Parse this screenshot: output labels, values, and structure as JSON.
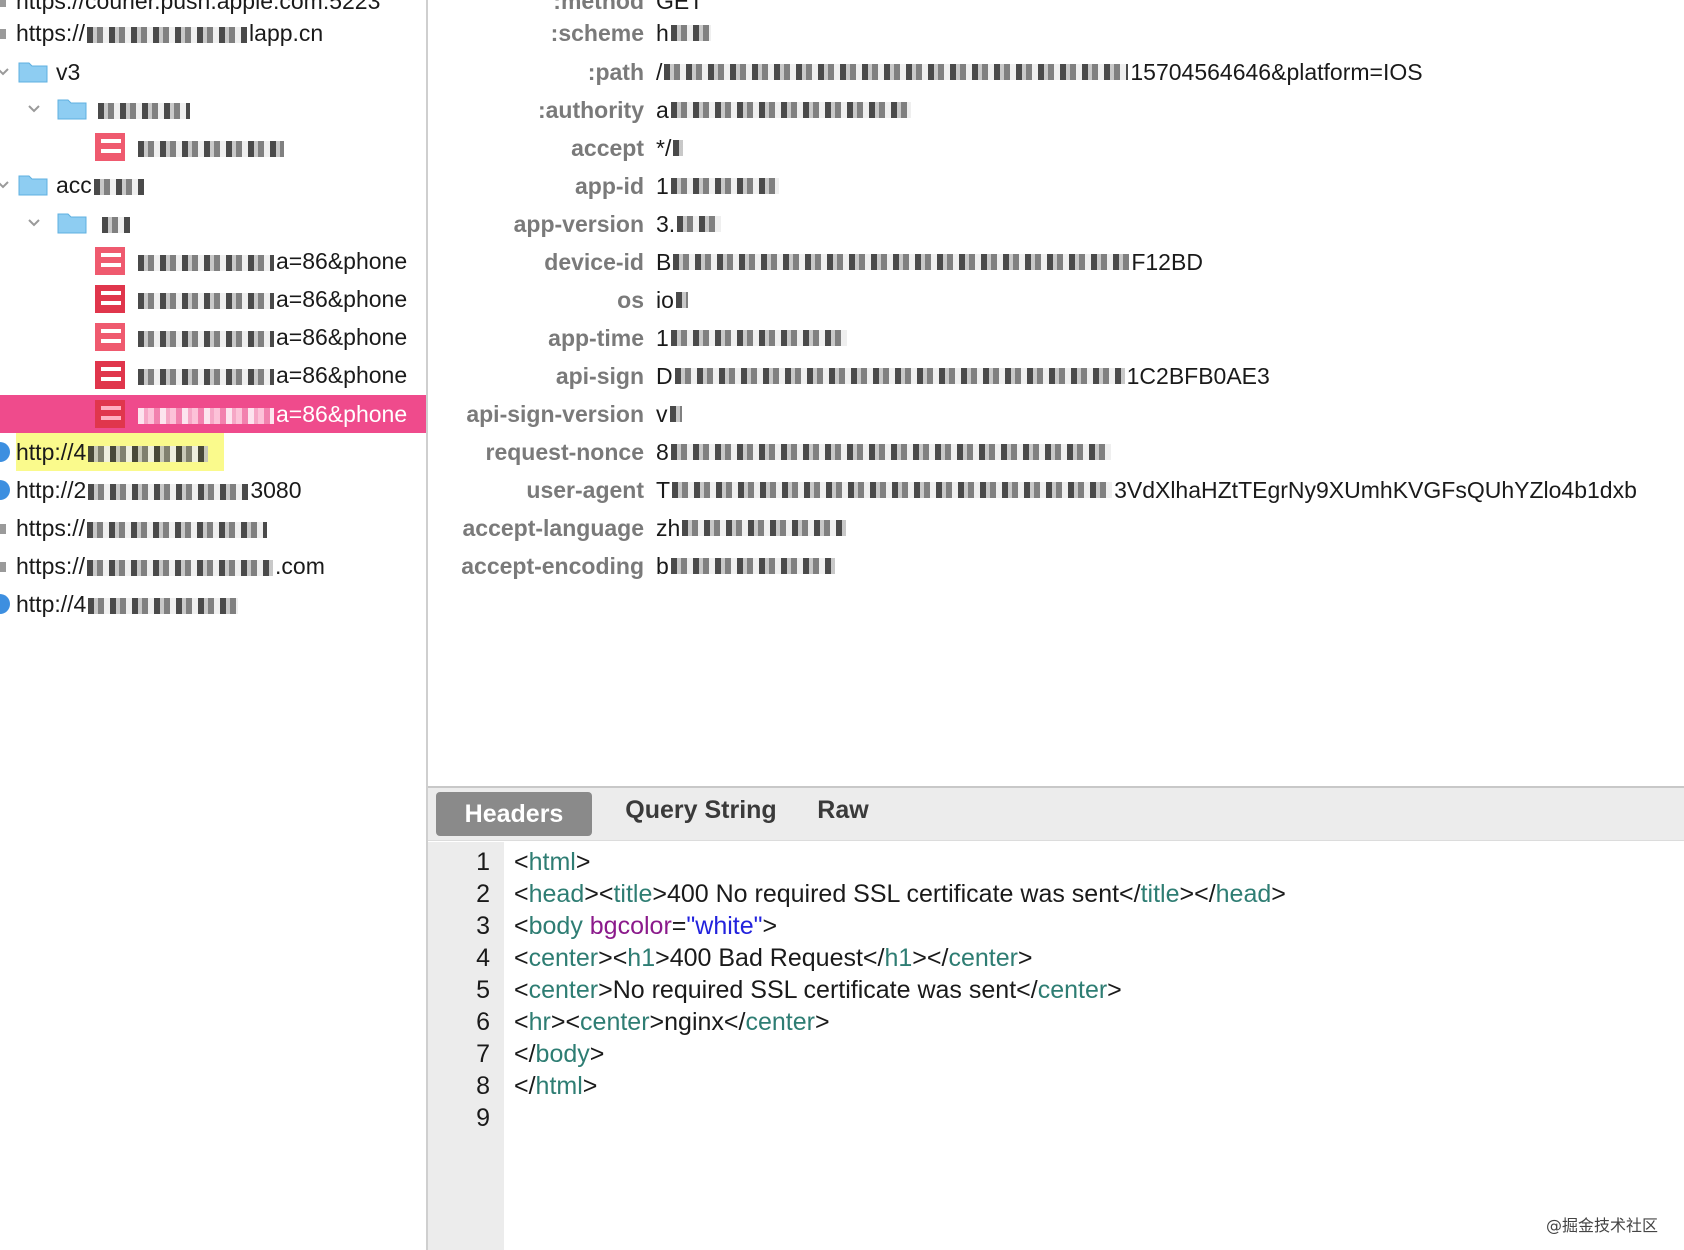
{
  "tree": {
    "rows": [
      {
        "type": "host-secure",
        "label": "https://courier.push.apple.com:5223"
      },
      {
        "type": "host-secure",
        "label_prefix": "https://",
        "label_suffix": "lapp.cn"
      },
      {
        "type": "folder",
        "label": "v3",
        "expanded": true
      },
      {
        "type": "folder",
        "label": "",
        "expanded": true
      },
      {
        "type": "request",
        "label": ""
      },
      {
        "type": "folder",
        "label": "acc",
        "expanded": true
      },
      {
        "type": "folder",
        "label": "",
        "expanded": true
      },
      {
        "type": "request",
        "label_suffix": "a=86&phone"
      },
      {
        "type": "request",
        "label_suffix": "a=86&phone"
      },
      {
        "type": "request",
        "label_suffix": "a=86&phone"
      },
      {
        "type": "request",
        "label_suffix": "a=86&phone"
      },
      {
        "type": "request",
        "label_suffix": "a=86&phone",
        "selected": true
      },
      {
        "type": "host-globe",
        "label_prefix": "http://4",
        "highlight": true
      },
      {
        "type": "host-globe",
        "label_prefix": "http://2",
        "label_suffix": "3080"
      },
      {
        "type": "host-secure",
        "label_prefix": "https://"
      },
      {
        "type": "host-secure",
        "label_prefix": "https://",
        "label_suffix": ".com"
      },
      {
        "type": "host-globe",
        "label_prefix": "http://4"
      }
    ]
  },
  "headers": {
    "rows": [
      {
        "name": ":method",
        "value": "GET"
      },
      {
        "name": ":scheme",
        "value": "h"
      },
      {
        "name": ":path",
        "value_prefix": "/",
        "value_suffix": "15704564646&platform=IOS"
      },
      {
        "name": ":authority",
        "value_prefix": "a"
      },
      {
        "name": "accept",
        "value_prefix": "*/"
      },
      {
        "name": "app-id",
        "value_prefix": "1"
      },
      {
        "name": "app-version",
        "value_prefix": "3."
      },
      {
        "name": "device-id",
        "value_prefix": "B",
        "value_suffix": "F12BD"
      },
      {
        "name": "os",
        "value_prefix": "io"
      },
      {
        "name": "app-time",
        "value_prefix": "1"
      },
      {
        "name": "api-sign",
        "value_prefix": "D",
        "value_suffix": "1C2BFB0AE3"
      },
      {
        "name": "api-sign-version",
        "value_prefix": "v"
      },
      {
        "name": "request-nonce",
        "value_prefix": "8"
      },
      {
        "name": "user-agent",
        "value_prefix": "T",
        "value_suffix": "3VdXlhaHZtTEgrNy9XUmhKVGFsQUhYZlo4b1dxb"
      },
      {
        "name": "accept-language",
        "value_prefix": "zh"
      },
      {
        "name": "accept-encoding",
        "value_prefix": "b"
      }
    ]
  },
  "response": {
    "tabs": [
      "Headers",
      "Query String",
      "Raw"
    ],
    "active_tab": "Headers",
    "line_numbers": [
      "1",
      "2",
      "3",
      "4",
      "5",
      "6",
      "7",
      "8",
      "9"
    ],
    "code": {
      "l1_tag": "html",
      "l2_tag_head": "head",
      "l2_tag_title": "title",
      "l2_text": "400 No required SSL certificate was sent",
      "l3_tag": "body",
      "l3_attr": "bgcolor",
      "l3_value": "\"white\"",
      "l4_tag_center": "center",
      "l4_tag_h1": "h1",
      "l4_text": "400 Bad Request",
      "l5_tag": "center",
      "l5_text": "No required SSL certificate was sent",
      "l6_tag_hr": "hr",
      "l6_tag_center": "center",
      "l6_text": "nginx",
      "l7_tag": "body",
      "l8_tag": "html"
    }
  },
  "watermark": "@掘金技术社区",
  "colors": {
    "selection": "#ef4b8c",
    "highlight": "#fafa8c",
    "tag": "#2e7d73",
    "attr": "#8b1a8b",
    "string": "#2222dd"
  }
}
